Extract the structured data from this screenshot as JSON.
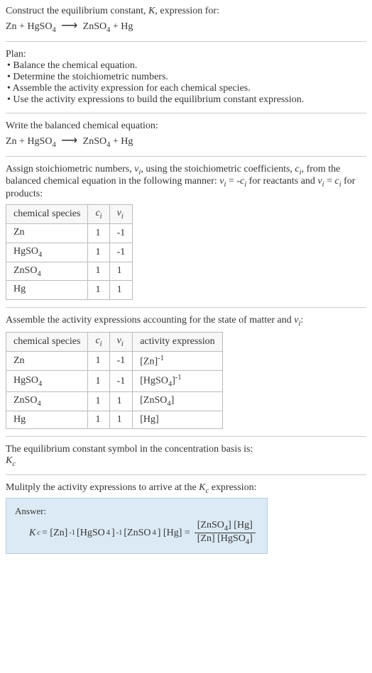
{
  "intro": {
    "line1": "Construct the equilibrium constant, ",
    "kvar": "K",
    "line1b": ", expression for:",
    "eq_lhs1": "Zn + HgSO",
    "eq_sub1": "4",
    "eq_arrow": "⟶",
    "eq_rhs1": "ZnSO",
    "eq_sub2": "4",
    "eq_rhs1b": " + Hg"
  },
  "plan": {
    "title": "Plan:",
    "b1": "• Balance the chemical equation.",
    "b2": "• Determine the stoichiometric numbers.",
    "b3": "• Assemble the activity expression for each chemical species.",
    "b4": "• Use the activity expressions to build the equilibrium constant expression."
  },
  "balanced": {
    "title": "Write the balanced chemical equation:"
  },
  "assign": {
    "pre": "Assign stoichiometric numbers, ",
    "nu": "ν",
    "sub_i": "i",
    "mid1": ", using the stoichiometric coefficients, ",
    "c": "c",
    "mid2": ", from the balanced chemical equation in the following manner: ",
    "rel1a": " = -",
    "rel1b": " for reactants and ",
    "rel2a": " = ",
    "rel2b": " for products:"
  },
  "table1": {
    "h1": "chemical species",
    "h2": "c",
    "h2sub": "i",
    "h3": "ν",
    "h3sub": "i",
    "rows": [
      {
        "sp": "Zn",
        "spsub": "",
        "c": "1",
        "nu": "-1"
      },
      {
        "sp": "HgSO",
        "spsub": "4",
        "c": "1",
        "nu": "-1"
      },
      {
        "sp": "ZnSO",
        "spsub": "4",
        "c": "1",
        "nu": "1"
      },
      {
        "sp": "Hg",
        "spsub": "",
        "c": "1",
        "nu": "1"
      }
    ]
  },
  "assemble": {
    "text": "Assemble the activity expressions accounting for the state of matter and ",
    "nu": "ν",
    "sub_i": "i",
    "colon": ":"
  },
  "table2": {
    "h1": "chemical species",
    "h2": "c",
    "h2sub": "i",
    "h3": "ν",
    "h3sub": "i",
    "h4": "activity expression",
    "rows": [
      {
        "sp": "Zn",
        "spsub": "",
        "c": "1",
        "nu": "-1",
        "act": "[Zn]",
        "exp": "-1"
      },
      {
        "sp": "HgSO",
        "spsub": "4",
        "c": "1",
        "nu": "-1",
        "act": "[HgSO",
        "actsub": "4",
        "actclose": "]",
        "exp": "-1"
      },
      {
        "sp": "ZnSO",
        "spsub": "4",
        "c": "1",
        "nu": "1",
        "act": "[ZnSO",
        "actsub": "4",
        "actclose": "]",
        "exp": ""
      },
      {
        "sp": "Hg",
        "spsub": "",
        "c": "1",
        "nu": "1",
        "act": "[Hg]",
        "exp": ""
      }
    ]
  },
  "symbol": {
    "line": "The equilibrium constant symbol in the concentration basis is:",
    "kc": "K",
    "kcsub": "c"
  },
  "multiply": {
    "line": "Mulitply the activity expressions to arrive at the ",
    "kc": "K",
    "kcsub": "c",
    "tail": " expression:"
  },
  "answer": {
    "label": "Answer:",
    "kc": "K",
    "kcsub": "c",
    "eq": " = [Zn]",
    "exp1": "-1",
    "part2": " [HgSO",
    "sub2": "4",
    "part2b": "]",
    "exp2": "-1",
    "part3": " [ZnSO",
    "sub3": "4",
    "part3b": "] [Hg] = ",
    "num": "[ZnSO",
    "numsub": "4",
    "numb": "] [Hg]",
    "den": "[Zn] [HgSO",
    "densub": "4",
    "denb": "]"
  }
}
